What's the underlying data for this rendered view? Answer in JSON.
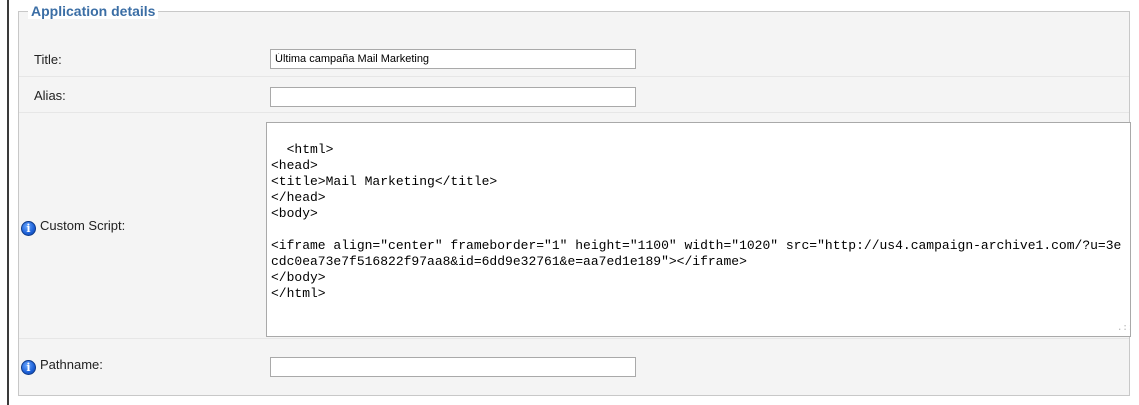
{
  "legend": "Application details",
  "fields": {
    "title": {
      "label": "Title:",
      "value": "Última campaña Mail Marketing"
    },
    "alias": {
      "label": "Alias:",
      "value": ""
    },
    "script": {
      "label": "Custom Script:",
      "value": "<html>\n<head>\n<title>Mail Marketing</title>\n</head>\n<body>\n\n<iframe align=\"center\" frameborder=\"1\" height=\"1100\" width=\"1020\" src=\"http://us4.campaign-archive1.com/?u=3ecdc0ea73e7f516822f97aa8&id=6dd9e32761&e=aa7ed1e189\"></iframe>\n</body>\n</html>"
    },
    "pathname": {
      "label": "Pathname:",
      "value": ""
    }
  },
  "icons": {
    "info": "info-icon"
  },
  "colors": {
    "legend": "#3b6ea5",
    "info_icon": "#1c5fd6"
  }
}
